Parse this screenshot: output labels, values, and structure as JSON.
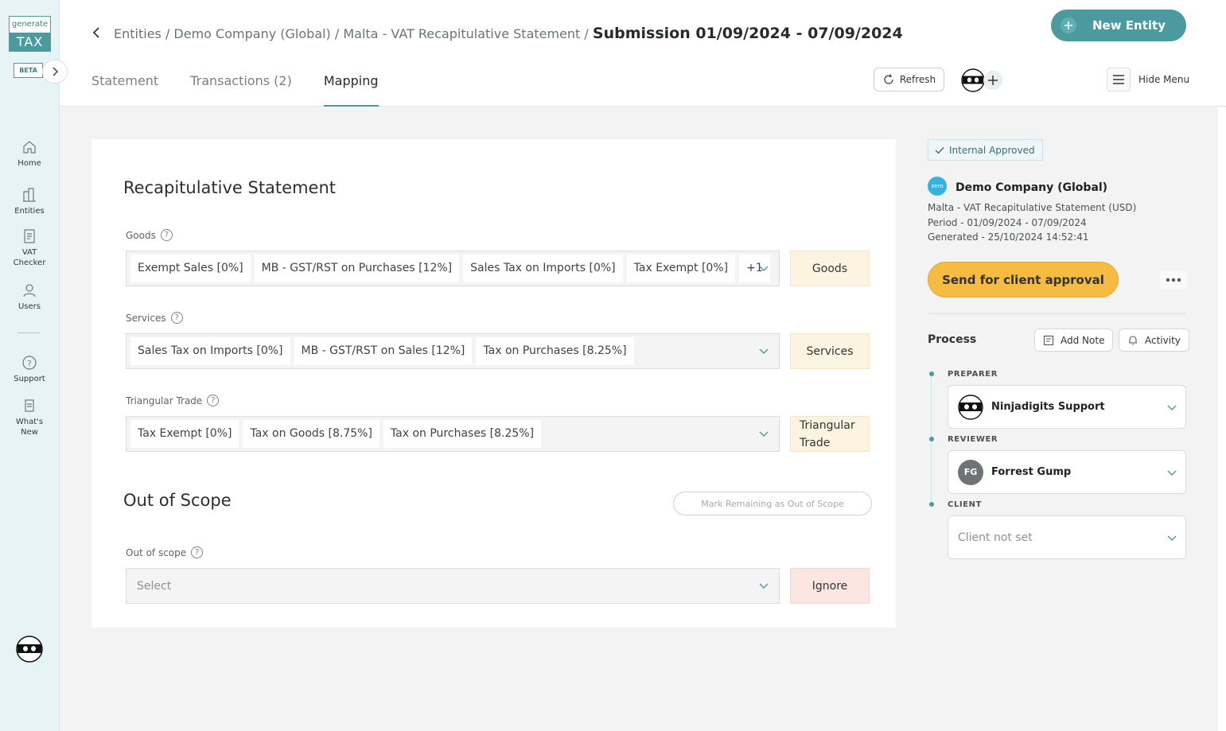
{
  "sidebar": {
    "logo_top": "generate",
    "logo_bottom": "TAX",
    "beta": "BETA",
    "items": [
      {
        "label": "Home",
        "icon": "home-icon"
      },
      {
        "label": "Entities",
        "icon": "buildings-icon"
      },
      {
        "label": "VAT Checker",
        "icon": "document-icon"
      },
      {
        "label": "Users",
        "icon": "user-icon"
      },
      {
        "label": "Support",
        "icon": "question-icon"
      },
      {
        "label": "What's New",
        "icon": "news-icon"
      }
    ]
  },
  "header": {
    "breadcrumb_path": "Entities / Demo Company (Global) / Malta - VAT Recapitulative Statement / ",
    "breadcrumb_current": "Submission 01/09/2024 - 07/09/2024",
    "new_entity_label": "New Entity",
    "tabs": [
      {
        "label": "Statement",
        "active": false
      },
      {
        "label": "Transactions (2)",
        "active": false
      },
      {
        "label": "Mapping",
        "active": true
      }
    ],
    "refresh_label": "Refresh",
    "hide_menu_label": "Hide Menu"
  },
  "recap": {
    "title": "Recapitulative Statement",
    "goods": {
      "label": "Goods",
      "chips": [
        "Exempt Sales [0%]",
        "MB - GST/RST on Purchases [12%]",
        "Sales Tax on Imports [0%]",
        "Tax Exempt [0%]",
        "+1"
      ],
      "button": "Goods"
    },
    "services": {
      "label": "Services",
      "chips": [
        "Sales Tax on Imports [0%]",
        "MB - GST/RST on Sales [12%]",
        "Tax on Purchases [8.25%]"
      ],
      "button": "Services"
    },
    "triangular": {
      "label": "Triangular Trade",
      "chips": [
        "Tax Exempt [0%]",
        "Tax on Goods [8.75%]",
        "Tax on Purchases [8.25%]"
      ],
      "button": "Triangular Trade"
    }
  },
  "out_of_scope": {
    "title": "Out of Scope",
    "mark_remaining": "Mark Remaining as Out of Scope",
    "label": "Out of scope",
    "placeholder": "Select",
    "button": "Ignore"
  },
  "right_panel": {
    "status": "Internal Approved",
    "xero_label": "xero",
    "company": "Demo Company (Global)",
    "meta": [
      "Malta - VAT Recapitulative Statement (USD)",
      "Period - 01/09/2024 - 07/09/2024",
      "Generated - 25/10/2024 14:52:41"
    ],
    "send_label": "Send for client approval",
    "process_title": "Process",
    "add_note": "Add Note",
    "activity": "Activity",
    "preparer_label": "PREPARER",
    "preparer": "Ninjadigits Support",
    "reviewer_label": "REVIEWER",
    "reviewer": "Forrest Gump",
    "reviewer_initials": "FG",
    "client_label": "CLIENT",
    "client": "Client not set"
  },
  "colors": {
    "accent": "#4a9aa0",
    "sidebar_bg": "#e6f4f5",
    "category_bg": "#fdf3e1",
    "ignore_bg": "#fbe6e1",
    "send_button": "#f6bb42"
  }
}
